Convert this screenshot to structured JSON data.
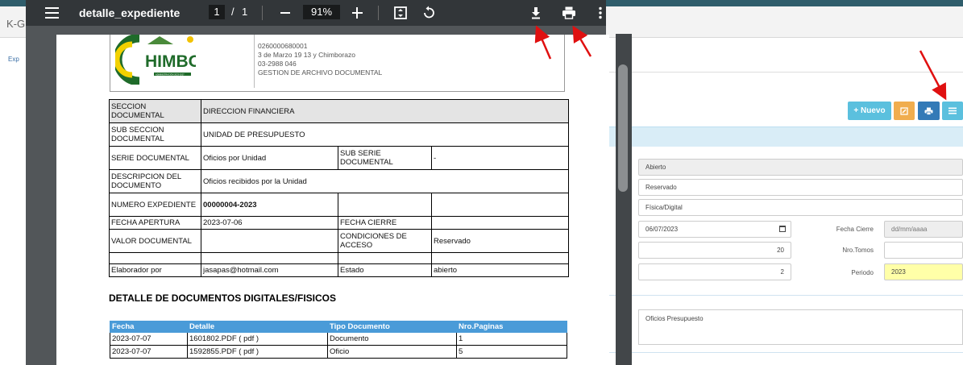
{
  "app": {
    "tab_title": "K-G",
    "sub_label": "Exp",
    "buttons": {
      "nuevo": "Nuevo"
    },
    "fields": {
      "estado": "Abierto",
      "condiciones_acceso": "Reservado",
      "tipo": "Física/Digital",
      "fecha_apertura": "06/07/2023",
      "fecha_cierre_label": "Fecha Cierre",
      "fecha_cierre_placeholder": "dd/mm/aaaa",
      "tomos_label": "Nro.Tomos",
      "paginas_value": "20",
      "tomos_value": "2",
      "periodo_label": "Periodo",
      "periodo_value": "2023",
      "descripcion": "Oficios Presupuesto"
    }
  },
  "viewer": {
    "title": "detalle_expediente",
    "page_current": "1",
    "page_separator": "/",
    "page_total": "1",
    "zoom": "91%"
  },
  "document": {
    "header_lines": [
      "0260000680001",
      "3 de Marzo 19 13 y Chimborazo",
      "03-2988 046",
      "GESTION DE ARCHIVO DOCUMENTAL"
    ],
    "logo_text": "HIMBO",
    "logo_sub": "ADMINISTRACIÓN 2023-2027",
    "meta": {
      "seccion_label": "SECCION DOCUMENTAL",
      "seccion_value": "DIRECCION FINANCIERA",
      "subseccion_label": "SUB SECCION DOCUMENTAL",
      "subseccion_value": "UNIDAD DE PRESUPUESTO",
      "serie_label": "SERIE DOCUMENTAL",
      "serie_value": "Oficios por Unidad",
      "subserie_label": "SUB SERIE DOCUMENTAL",
      "subserie_value": "-",
      "descripcion_label": "DESCRIPCION DEL DOCUMENTO",
      "descripcion_value": "Oficios recibidos por la Unidad",
      "numero_label": "NUMERO EXPEDIENTE",
      "numero_value": "00000004-2023",
      "apertura_label": "FECHA APERTURA",
      "apertura_value": "2023-07-06",
      "cierre_label": "FECHA CIERRE",
      "cierre_value": "",
      "valor_label": "VALOR DOCUMENTAL",
      "valor_value": "",
      "condiciones_label": "CONDICIONES DE ACCESO",
      "condiciones_value": "Reservado",
      "elaborador_label": "Elaborador por",
      "elaborador_value": "jasapas@hotmail.com",
      "estado_label": "Estado",
      "estado_value": "abierto"
    },
    "section_title": "DETALLE DE DOCUMENTOS DIGITALES/FISICOS",
    "docs_headers": [
      "Fecha",
      "Detalle",
      "Tipo Documento",
      "Nro.Paginas"
    ],
    "docs_rows": [
      [
        "2023-07-07",
        "1601802.PDF ( pdf )",
        "Documento",
        "1"
      ],
      [
        "2023-07-07",
        "1592855.PDF ( pdf )",
        "Oficio",
        "5"
      ]
    ]
  },
  "colors": {
    "toolbar": "#323639",
    "viewer_bg": "#525659",
    "table_header": "#4a9bd8",
    "annotation_arrow": "#e01010"
  }
}
